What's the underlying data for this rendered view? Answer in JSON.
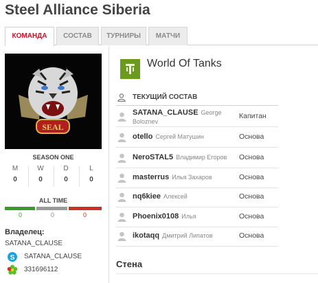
{
  "team": {
    "name": "Steel Alliance Siberia"
  },
  "tabs": [
    {
      "label": "КОМАНДА",
      "active": true
    },
    {
      "label": "СОСТАВ",
      "active": false
    },
    {
      "label": "ТУРНИРЫ",
      "active": false
    },
    {
      "label": "МАТЧИ",
      "active": false
    }
  ],
  "logo": {
    "text": "SEAL"
  },
  "season": {
    "title": "SEASON ONE",
    "stats": [
      {
        "label": "M",
        "value": "0"
      },
      {
        "label": "W",
        "value": "0"
      },
      {
        "label": "D",
        "value": "0"
      },
      {
        "label": "L",
        "value": "0"
      }
    ]
  },
  "all_time": {
    "title": "ALL TIME",
    "bars": [
      {
        "value": "0",
        "color": "#3a9a2a"
      },
      {
        "value": "0",
        "color": "#9a9a9a"
      },
      {
        "value": "0",
        "color": "#c8322e"
      }
    ]
  },
  "owner": {
    "label": "Владелец:",
    "name": "SATANA_CLAUSE",
    "skype": "SATANA_CLAUSE",
    "icq": "331696112"
  },
  "game": {
    "title": "World Of Tanks",
    "icon": "world-of-tanks-logo-icon"
  },
  "roster": {
    "title": "ТЕКУЩИЙ СОСТАВ",
    "members": [
      {
        "nick": "SATANA_CLAUSE",
        "real": "George Boloznev",
        "role": "Капитан"
      },
      {
        "nick": "otello",
        "real": "Сергей Матушин",
        "role": "Основа"
      },
      {
        "nick": "NeroSTAL5",
        "real": "Владимир Егоров",
        "role": "Основа"
      },
      {
        "nick": "masterrus",
        "real": "Илья Захаров",
        "role": "Основа"
      },
      {
        "nick": "nq6kiee",
        "real": "Алексей",
        "role": "Основа"
      },
      {
        "nick": "Phoenix0108",
        "real": "Илья",
        "role": "Основа"
      },
      {
        "nick": "ikotaqq",
        "real": "Дмитрий Липатов",
        "role": "Основа"
      }
    ]
  },
  "wall": {
    "title": "Стена"
  },
  "colors": {
    "accent": "#c0192b",
    "win": "#3a9a2a",
    "draw": "#9a9a9a",
    "loss": "#c8322e",
    "game_green": "#6a9b1e"
  }
}
